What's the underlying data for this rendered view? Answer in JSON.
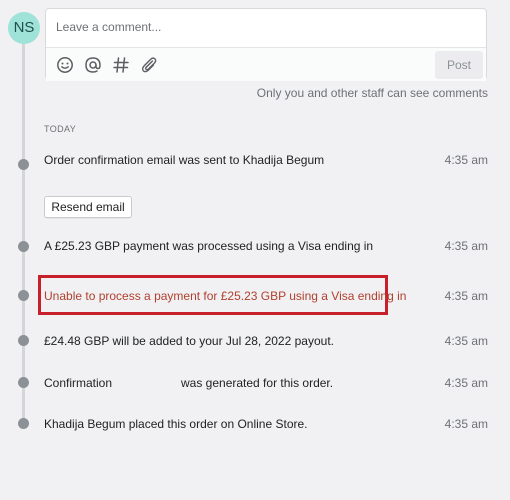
{
  "avatar": {
    "initials": "NS"
  },
  "comment": {
    "placeholder": "Leave a comment...",
    "post_label": "Post",
    "note": "Only you and other staff can see comments"
  },
  "timeline": {
    "section_label": "TODAY",
    "resend_label": "Resend email",
    "events": [
      {
        "text": "Order confirmation email was sent to Khadija Begum",
        "time": "4:35 am"
      },
      {
        "text": "A £25.23 GBP payment was processed using a Visa ending in",
        "time": "4:35 am"
      },
      {
        "text": "Unable to process a payment for £25.23 GBP using a Visa ending in",
        "time": "4:35 am"
      },
      {
        "text": "£24.48 GBP will be added to your Jul 28, 2022 payout.",
        "time": "4:35 am"
      },
      {
        "text_before": "Confirmation",
        "text_after": "was generated for this order.",
        "time": "4:35 am"
      },
      {
        "text": "Khadija Begum placed this order on Online Store.",
        "time": "4:35 am"
      }
    ]
  },
  "colors": {
    "accent_avatar": "#9fe3d8",
    "error_text": "#b0402e",
    "highlight_border": "#c8202a"
  }
}
